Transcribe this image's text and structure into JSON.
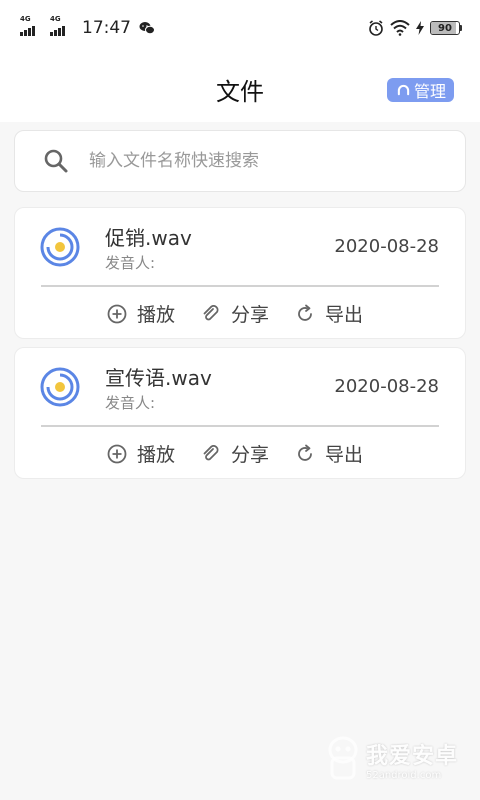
{
  "status_bar": {
    "network_1": "4G",
    "network_2": "4G",
    "time": "17:47",
    "battery_level": "90"
  },
  "header": {
    "title": "文件",
    "manage_label": "管理"
  },
  "search": {
    "placeholder": "输入文件名称快速搜索",
    "value": ""
  },
  "files": [
    {
      "name": "促销.wav",
      "speaker_label": "发音人:",
      "date": "2020-08-28",
      "actions": {
        "play": "播放",
        "share": "分享",
        "export": "导出"
      }
    },
    {
      "name": "宣传语.wav",
      "speaker_label": "发音人:",
      "date": "2020-08-28",
      "actions": {
        "play": "播放",
        "share": "分享",
        "export": "导出"
      }
    }
  ],
  "watermark": {
    "text_cn": "我爱安卓",
    "text_en": "52android.com"
  },
  "colors": {
    "accent": "#7d9cf0",
    "disc_blue": "#5b86e5",
    "disc_yellow": "#f2c53d",
    "background": "#f7f7f7"
  },
  "icons": {
    "search": "search-icon",
    "manage": "headphones-icon",
    "file": "disc-icon",
    "play": "plus-circle-icon",
    "share": "paperclip-icon",
    "export": "refresh-icon"
  }
}
